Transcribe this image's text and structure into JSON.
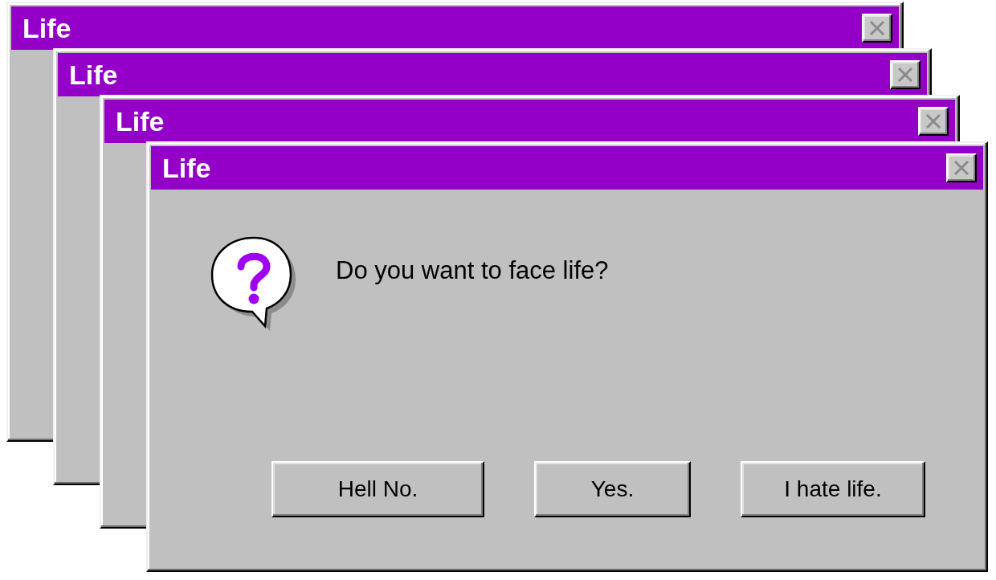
{
  "windows": [
    {
      "title": "Life"
    },
    {
      "title": "Life"
    },
    {
      "title": "Life"
    },
    {
      "title": "Life",
      "message": "Do you want to face life?",
      "buttons": [
        {
          "label": "Hell No."
        },
        {
          "label": "Yes."
        },
        {
          "label": "I hate life."
        }
      ]
    }
  ]
}
